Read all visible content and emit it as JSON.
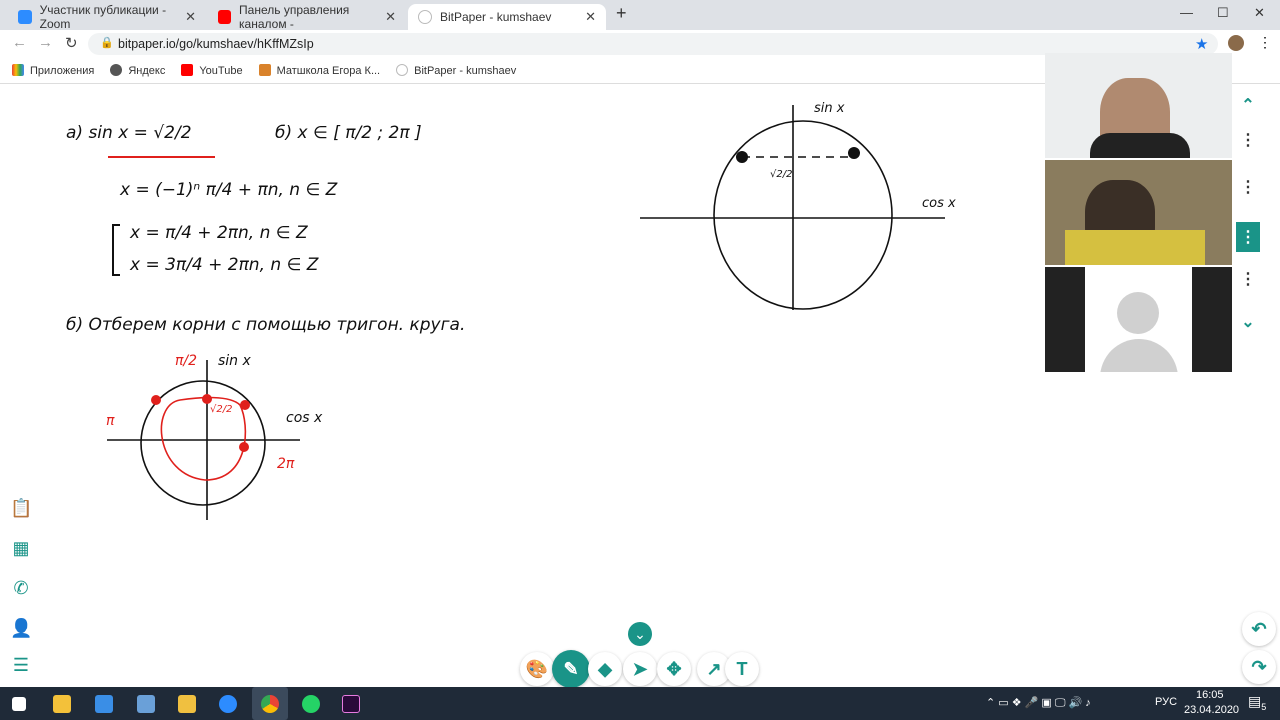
{
  "browser": {
    "tabs": [
      {
        "label": "Участник публикации - Zoom",
        "icon": "zoom-icon",
        "color": "#2d8cff"
      },
      {
        "label": "Панель управления каналом - ",
        "icon": "youtube-icon",
        "color": "#ff0000"
      },
      {
        "label": "BitPaper - kumshaev",
        "icon": "bitpaper-icon",
        "active": true
      }
    ],
    "url": "bitpaper.io/go/kumshaev/hKffMZsIp",
    "bookmarks": [
      {
        "label": "Приложения",
        "icon": "apps-icon"
      },
      {
        "label": "Яндекс",
        "icon": "globe-icon"
      },
      {
        "label": "YouTube",
        "icon": "youtube-icon"
      },
      {
        "label": "Матшкола Егора К...",
        "icon": "matschool-icon"
      },
      {
        "label": "BitPaper - kumshaev",
        "icon": "bitpaper-icon"
      }
    ]
  },
  "board": {
    "line_a": "а)   sin x = √2/2",
    "line_b": "б)  x ∈ [ π/2 ; 2π ]",
    "sol1": "x = (−1)ⁿ π/4 + πn, n ∈ Z",
    "sol2": "x = π/4 + 2πn, n ∈ Z",
    "sol3": "x = 3π/4 + 2πn, n ∈ Z",
    "line_c": "б)  Отберем корни с помощью тригон. круга.",
    "sin_label": "sin x",
    "cos_label": "cos x",
    "pi_half": "π/2",
    "pi": "π",
    "two_pi": "2π",
    "root2": "√2/2",
    "ink_color": "#111111",
    "red_ink": "#e0201c"
  },
  "toolbar": {
    "accent": "#1a9488",
    "text_tool": "T",
    "tools": [
      "palette",
      "pen",
      "eraser",
      "select",
      "move",
      "laser",
      "text"
    ]
  },
  "taskbar": {
    "lang": "РУС",
    "time": "16:05",
    "date": "23.04.2020",
    "notifications": "5"
  }
}
